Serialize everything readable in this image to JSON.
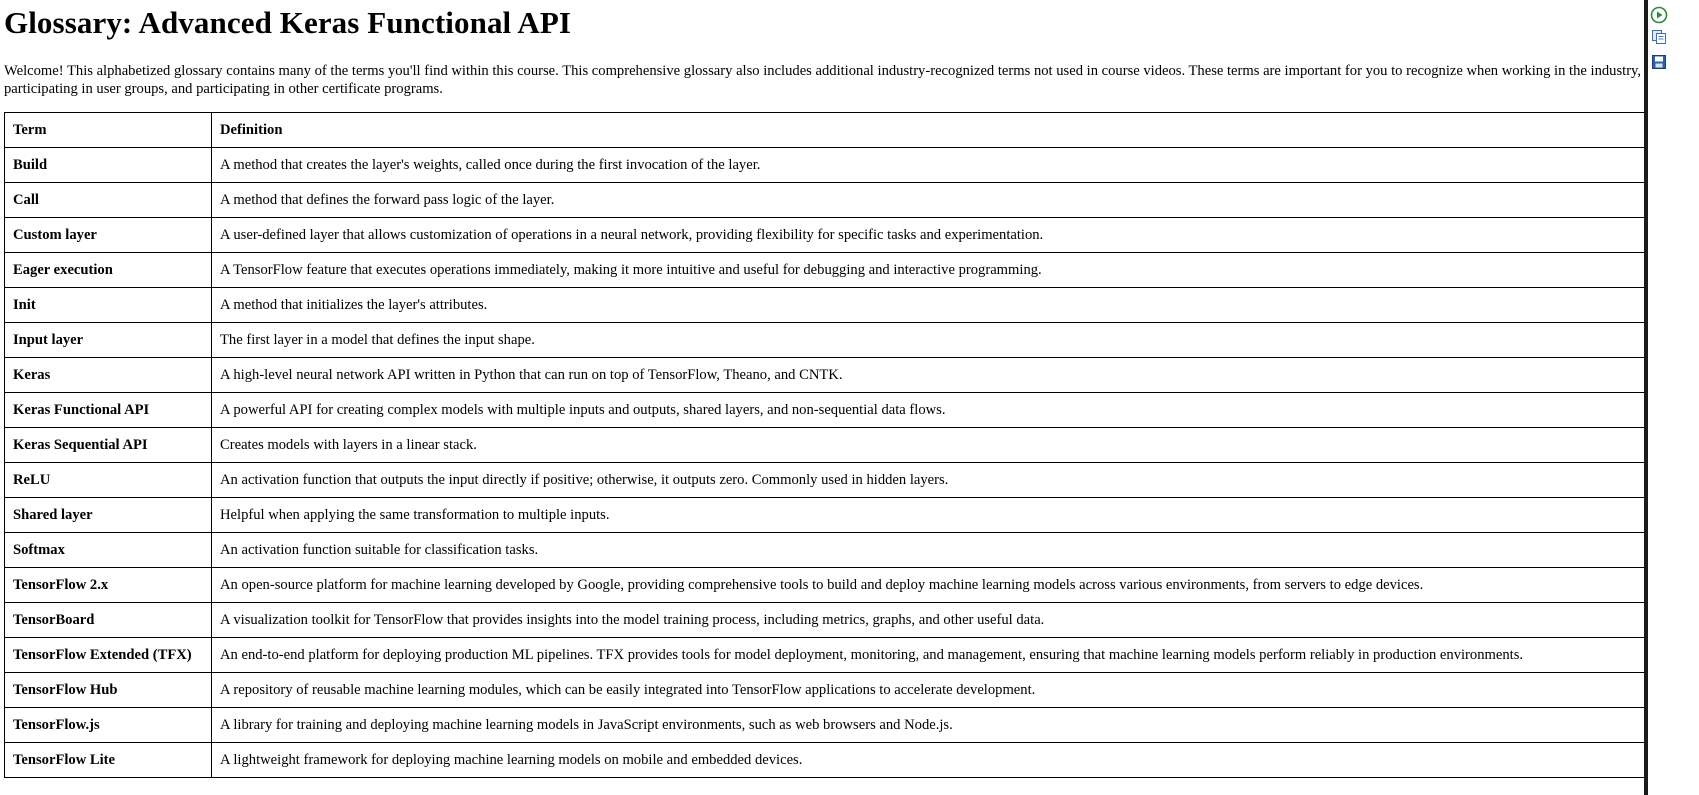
{
  "page": {
    "title": "Glossary: Advanced Keras Functional API",
    "intro": "Welcome! This alphabetized glossary contains many of the terms you'll find within this course. This comprehensive glossary also includes additional industry-recognized terms not used in course videos. These terms are important for you to recognize when working in the industry, participating in user groups, and participating in other certificate programs."
  },
  "table": {
    "headers": {
      "term": "Term",
      "definition": "Definition"
    },
    "rows": [
      {
        "term": "Build",
        "definition": "A method that creates the layer's weights, called once during the first invocation of the layer."
      },
      {
        "term": "Call",
        "definition": "A method that defines the forward pass logic of the layer."
      },
      {
        "term": "Custom layer",
        "definition": "A user-defined layer that allows customization of operations in a neural network, providing flexibility for specific tasks and experimentation."
      },
      {
        "term": "Eager execution",
        "definition": "A TensorFlow feature that executes operations immediately, making it more intuitive and useful for debugging and interactive programming."
      },
      {
        "term": "Init",
        "definition": "A method that initializes the layer's attributes."
      },
      {
        "term": "Input layer",
        "definition": "The first layer in a model that defines the input shape."
      },
      {
        "term": "Keras",
        "definition": "A high-level neural network API written in Python that can run on top of TensorFlow, Theano, and CNTK."
      },
      {
        "term": "Keras Functional API",
        "definition": "A powerful API for creating complex models with multiple inputs and outputs, shared layers, and non-sequential data flows."
      },
      {
        "term": "Keras Sequential API",
        "definition": "Creates models with layers in a linear stack."
      },
      {
        "term": "ReLU",
        "definition": "An activation function that outputs the input directly if positive; otherwise, it outputs zero. Commonly used in hidden layers."
      },
      {
        "term": "Shared layer",
        "definition": "Helpful when applying the same transformation to multiple inputs."
      },
      {
        "term": "Softmax",
        "definition": "An activation function suitable for classification tasks."
      },
      {
        "term": "TensorFlow 2.x",
        "definition": "An open-source platform for machine learning developed by Google, providing comprehensive tools to build and deploy machine learning models across various environments, from servers to edge devices."
      },
      {
        "term": "TensorBoard",
        "definition": "A visualization toolkit for TensorFlow that provides insights into the model training process, including metrics, graphs, and other useful data."
      },
      {
        "term": "TensorFlow Extended (TFX)",
        "definition": "An end-to-end platform for deploying production ML pipelines. TFX provides tools for model deployment, monitoring, and management, ensuring that machine learning models perform reliably in production environments."
      },
      {
        "term": "TensorFlow Hub",
        "definition": "A repository of reusable machine learning modules, which can be easily integrated into TensorFlow applications to accelerate development."
      },
      {
        "term": "TensorFlow.js",
        "definition": "A library for training and deploying machine learning models in JavaScript environments, such as web browsers and Node.js."
      },
      {
        "term": "TensorFlow Lite",
        "definition": "A lightweight framework for deploying machine learning models on mobile and embedded devices."
      }
    ]
  },
  "toolbar": {
    "icons": [
      "play-icon",
      "copy-icon",
      "save-icon"
    ],
    "colors": {
      "play": "#2a8a3a",
      "copy": "#3a6fb0",
      "save": "#2f5fa8"
    }
  }
}
